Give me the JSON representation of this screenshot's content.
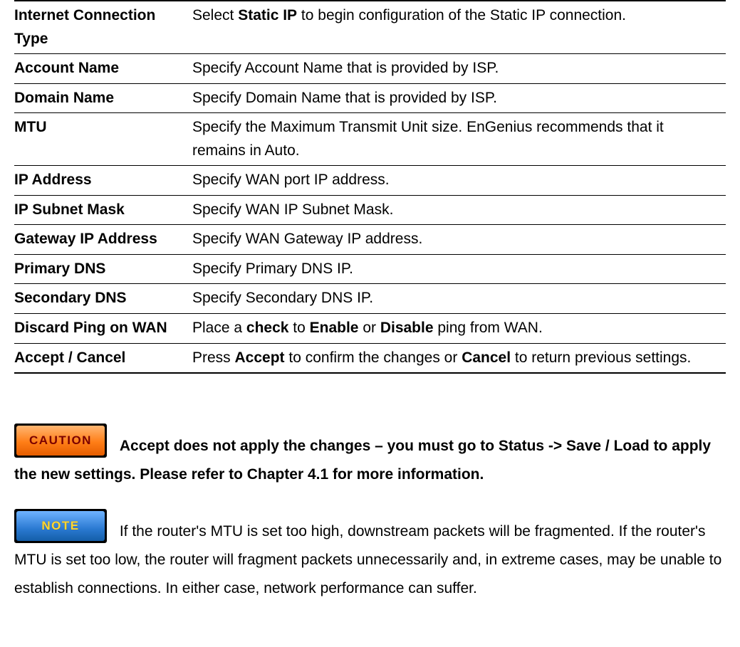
{
  "table": {
    "rows": [
      {
        "label": "Internet Connection Type",
        "desc_parts": [
          "Select ",
          "Static IP",
          " to begin configuration of the Static IP connection."
        ],
        "bold": [
          false,
          true,
          false
        ]
      },
      {
        "label": "Account Name",
        "desc_parts": [
          "Specify Account Name that is provided by ISP."
        ],
        "bold": [
          false
        ]
      },
      {
        "label": "Domain Name",
        "desc_parts": [
          "Specify Domain Name that is provided by ISP."
        ],
        "bold": [
          false
        ]
      },
      {
        "label": "MTU",
        "desc_parts": [
          "Specify the Maximum Transmit Unit size. EnGenius recommends that it remains in Auto."
        ],
        "bold": [
          false
        ]
      },
      {
        "label": "IP Address",
        "desc_parts": [
          "Specify WAN port IP address."
        ],
        "bold": [
          false
        ]
      },
      {
        "label": "IP Subnet Mask",
        "desc_parts": [
          "Specify WAN IP Subnet Mask."
        ],
        "bold": [
          false
        ]
      },
      {
        "label": "Gateway IP Address",
        "desc_parts": [
          "Specify WAN Gateway IP address."
        ],
        "bold": [
          false
        ]
      },
      {
        "label": "Primary DNS",
        "desc_parts": [
          "Specify Primary DNS IP."
        ],
        "bold": [
          false
        ]
      },
      {
        "label": "Secondary DNS",
        "desc_parts": [
          "Specify Secondary DNS IP."
        ],
        "bold": [
          false
        ]
      },
      {
        "label": "Discard Ping on WAN",
        "desc_parts": [
          "Place a ",
          "check",
          " to ",
          "Enable",
          " or ",
          "Disable",
          " ping from WAN."
        ],
        "bold": [
          false,
          true,
          false,
          true,
          false,
          true,
          false
        ]
      },
      {
        "label": "Accept / Cancel",
        "desc_parts": [
          "Press ",
          "Accept",
          " to confirm the changes or ",
          "Cancel",
          " to return previous settings."
        ],
        "bold": [
          false,
          true,
          false,
          true,
          false
        ]
      }
    ]
  },
  "caution": {
    "badge": "CAUTION",
    "text": "Accept does not apply the changes – you must go to Status -> Save / Load to apply the new settings. Please refer to Chapter 4.1 for more information."
  },
  "note": {
    "badge": "NOTE",
    "text": "If the router's MTU is set too high, downstream packets will be fragmented. If the router's MTU is set too low, the router will fragment packets unnecessarily and, in extreme cases, may be unable to establish connections. In either case, network performance can suffer."
  }
}
